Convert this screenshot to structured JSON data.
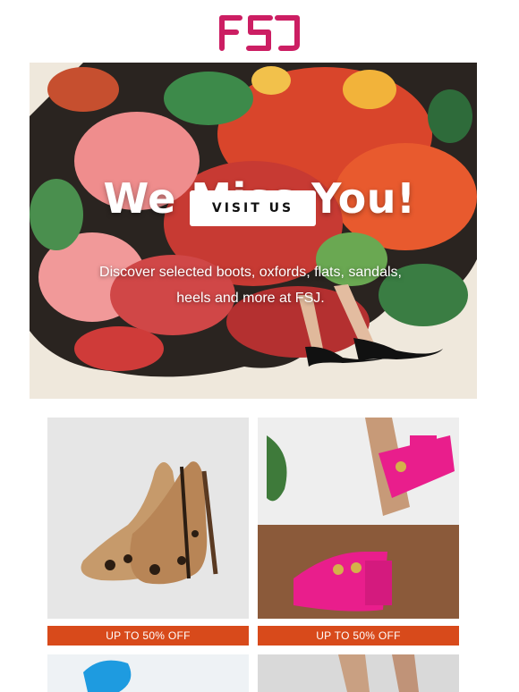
{
  "brand": {
    "logo_text": "FSJ",
    "color": "#cc1e63"
  },
  "hero": {
    "title": "We Miss You!",
    "button_label": "VISIT US",
    "description_line1": "Discover selected boots, oxfords, flats, sandals,",
    "description_line2": "heels and more at FSJ."
  },
  "products": [
    {
      "badge": "UP TO 50% OFF"
    },
    {
      "badge": "UP TO 50% OFF"
    }
  ],
  "colors": {
    "sale_bar": "#d84a1b",
    "button_bg": "#ffffff"
  }
}
